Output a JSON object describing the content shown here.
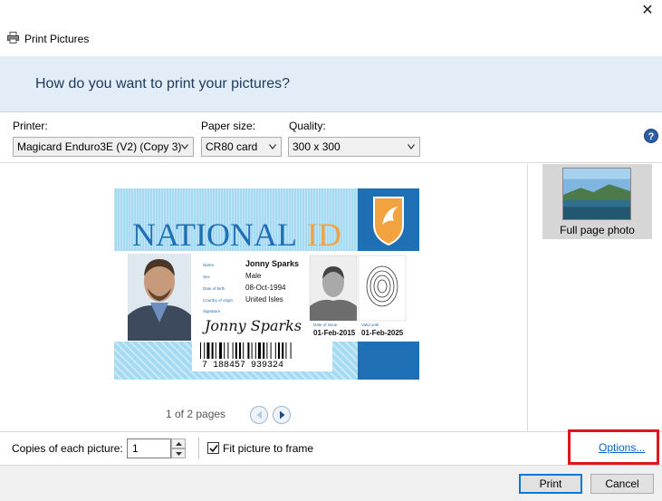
{
  "window": {
    "title": "Print Pictures",
    "close_glyph": "✕"
  },
  "header": {
    "question": "How do you want to print your pictures?"
  },
  "options": {
    "printer_label": "Printer:",
    "printer_value": "Magicard Enduro3E (V2) (Copy 3)",
    "paper_label": "Paper size:",
    "paper_value": "CR80 card",
    "quality_label": "Quality:",
    "quality_value": "300 x 300",
    "help_glyph": "?"
  },
  "preview": {
    "page_info": "1 of 2 pages",
    "card": {
      "title_main": "NATIONAL",
      "title_accent": "ID",
      "field_labels": [
        "Name",
        "Sex",
        "Date of birth",
        "Country of origin"
      ],
      "field_values": [
        "Jonny Sparks",
        "Male",
        "08-Oct-1994",
        "United Isles"
      ],
      "signature_label": "Signature",
      "signature": "Jonny Sparks",
      "date_issue_label": "Date of issue",
      "date_issue": "01-Feb-2015",
      "valid_until_label": "Valid until",
      "valid_until": "01-Feb-2025",
      "barcode_text": "7 188457 939324",
      "colors": {
        "blue": "#1f6fb5",
        "orange": "#f2a340",
        "light_blue": "#a6daf2"
      }
    }
  },
  "layouts": [
    {
      "label": "Full page photo",
      "selected": true
    }
  ],
  "bottom": {
    "copies_label": "Copies of each picture:",
    "copies_value": "1",
    "fit_label": "Fit picture to frame",
    "fit_checked": true,
    "options_link": "Options..."
  },
  "buttons": {
    "print": "Print",
    "cancel": "Cancel"
  },
  "accent": {
    "highlight": "#e0161c",
    "link": "#0066cc"
  }
}
